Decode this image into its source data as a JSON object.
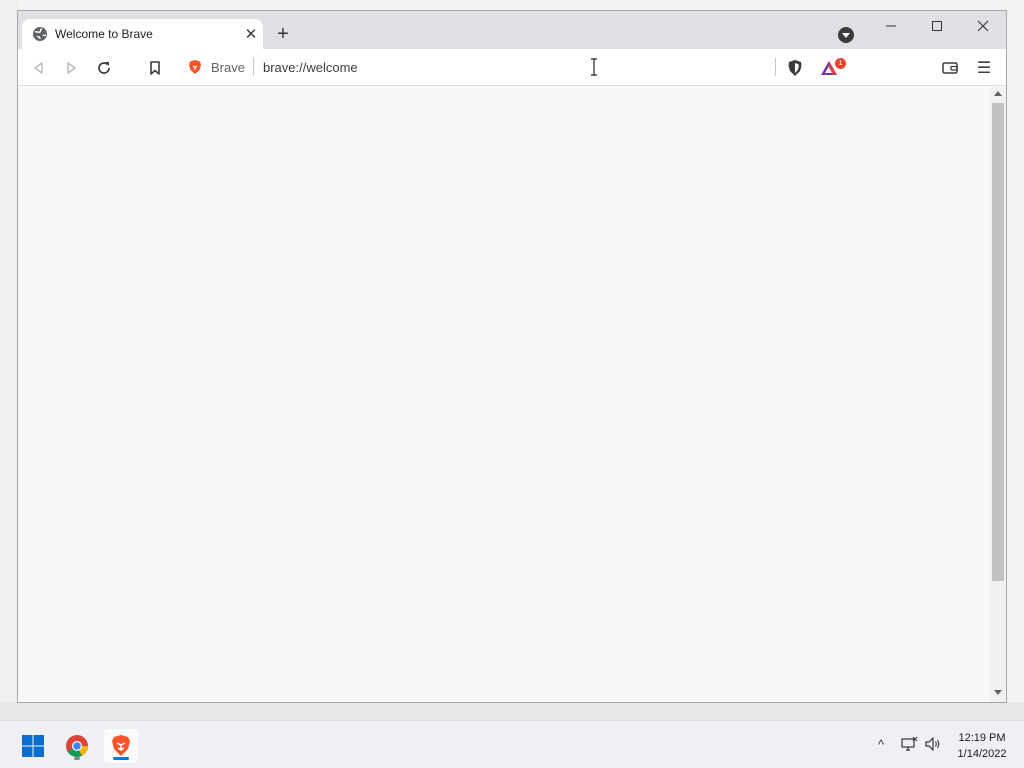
{
  "browser": {
    "tab": {
      "title": "Welcome to Brave",
      "close_glyph": "✕"
    },
    "new_tab_glyph": "+",
    "omnibox": {
      "brand": "Brave",
      "url": "brave://welcome"
    },
    "rewards_badge": "1",
    "menu_glyph": "☰"
  },
  "taskbar": {
    "clock": {
      "time": "12:19 PM",
      "date": "1/14/2022"
    },
    "tray_chevron_glyph": "^"
  },
  "colors": {
    "brave_orange": "#fb542b",
    "accent_blue": "#0078d4",
    "windows_blue": "#0a6ed1"
  }
}
